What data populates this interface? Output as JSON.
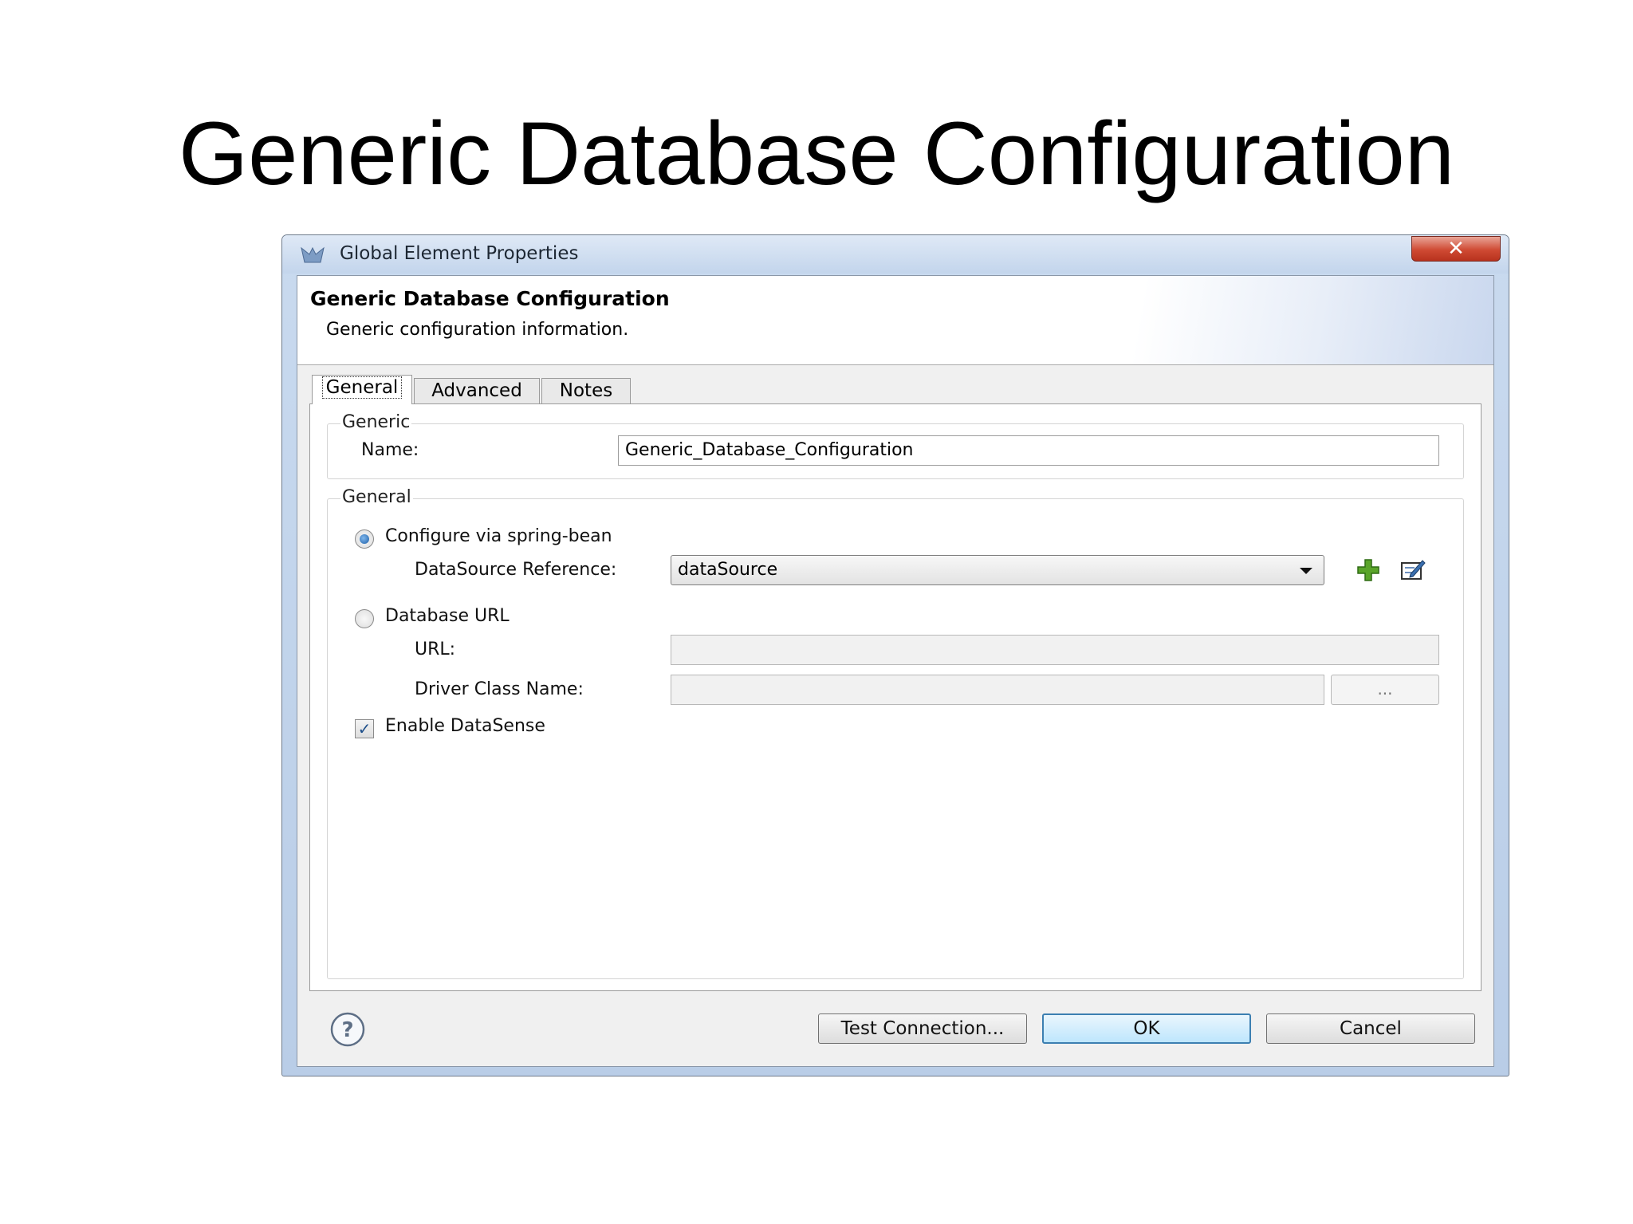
{
  "slide": {
    "title": "Generic Database Configuration"
  },
  "window": {
    "title": "Global Element Properties",
    "close_label": "✕"
  },
  "header": {
    "title": "Generic Database Configuration",
    "description": "Generic configuration information."
  },
  "tabs": [
    {
      "label": "General",
      "active": true
    },
    {
      "label": "Advanced",
      "active": false
    },
    {
      "label": "Notes",
      "active": false
    }
  ],
  "generic_group": {
    "legend": "Generic",
    "name_label": "Name:",
    "name_value": "Generic_Database_Configuration"
  },
  "general_group": {
    "legend": "General",
    "spring_bean_option": {
      "label": "Configure via spring-bean",
      "selected": true
    },
    "datasource_label": "DataSource Reference:",
    "datasource_value": "dataSource",
    "database_url_option": {
      "label": "Database URL",
      "selected": false
    },
    "url_label": "URL:",
    "url_value": "",
    "driver_label": "Driver Class Name:",
    "driver_value": "",
    "browse_label": "...",
    "datasense": {
      "label": "Enable DataSense",
      "checked": true
    }
  },
  "icons": {
    "add": "plus-icon",
    "edit": "edit-icon",
    "help": "help-icon",
    "app": "app-icon"
  },
  "footer": {
    "test_label": "Test Connection...",
    "ok_label": "OK",
    "cancel_label": "Cancel"
  },
  "colors": {
    "accent": "#3c7fb1",
    "titlebar": "#c3d5ec",
    "close": "#cf4a33",
    "add_icon": "#5aa42a"
  }
}
